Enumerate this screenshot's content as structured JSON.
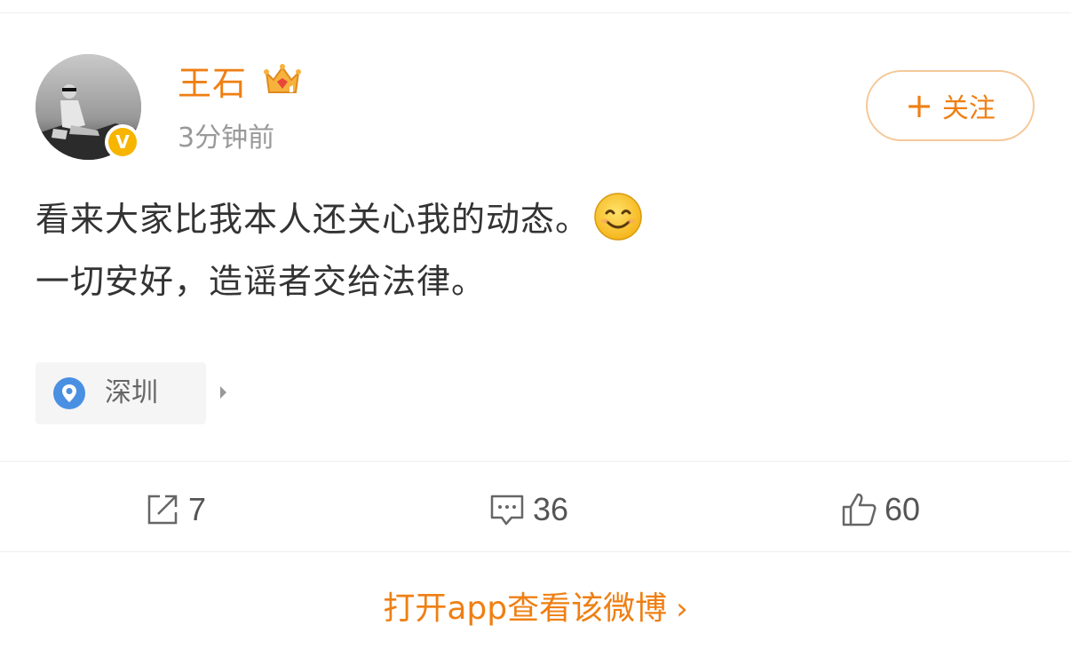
{
  "post": {
    "author": {
      "name": "王石",
      "verified_badge": "V",
      "crown_icon": "crown-badge-icon"
    },
    "timestamp": "3分钟前",
    "follow_label": "关注",
    "text_line1": "看来大家比我本人还关心我的动态。",
    "emoji": "smiling-face-emoji",
    "text_line2": "一切安好，造谣者交给法律。",
    "location": "深圳"
  },
  "actions": {
    "repost_count": "7",
    "comment_count": "36",
    "like_count": "60"
  },
  "open_app_label": "打开app查看该微博",
  "colors": {
    "accent": "#ef7f13",
    "verified": "#f7b500",
    "location_pin": "#4a90e2"
  }
}
